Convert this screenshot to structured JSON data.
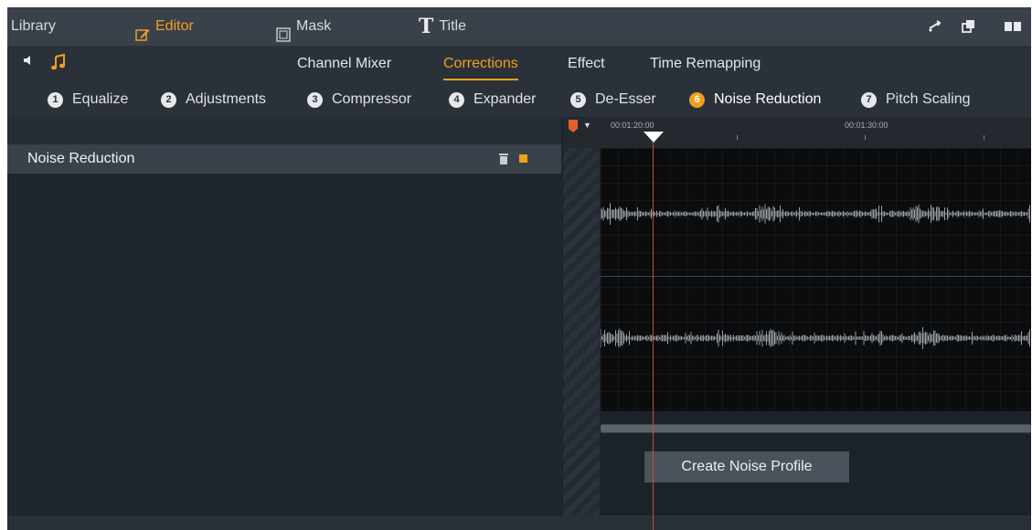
{
  "topbar": {
    "library": "Library",
    "editor": "Editor",
    "mask": "Mask",
    "title": "Title"
  },
  "subnav": {
    "tabs": [
      {
        "label": "Channel Mixer"
      },
      {
        "label": "Corrections",
        "active": true
      },
      {
        "label": "Effect"
      },
      {
        "label": "Time Remapping"
      }
    ]
  },
  "steps": [
    {
      "num": "1",
      "label": "Equalize"
    },
    {
      "num": "2",
      "label": "Adjustments"
    },
    {
      "num": "3",
      "label": "Compressor"
    },
    {
      "num": "4",
      "label": "Expander"
    },
    {
      "num": "5",
      "label": "De-Esser"
    },
    {
      "num": "6",
      "label": "Noise Reduction",
      "active": true
    },
    {
      "num": "7",
      "label": "Pitch Scaling"
    }
  ],
  "panel": {
    "effect_name": "Noise Reduction"
  },
  "timeline": {
    "timecode_left": "00:01:20:00",
    "timecode_right": "00:01:30:00"
  },
  "actions": {
    "create_noise_profile": "Create Noise Profile"
  },
  "colors": {
    "accent": "#f0a020",
    "playhead": "#c8502a"
  },
  "icons": {
    "editor": "pencil-edit-icon",
    "mask": "mask-square-icon",
    "title": "title-t-icon",
    "audio": "music-note-icon",
    "speaker": "speaker-icon",
    "trash": "trash-icon"
  }
}
